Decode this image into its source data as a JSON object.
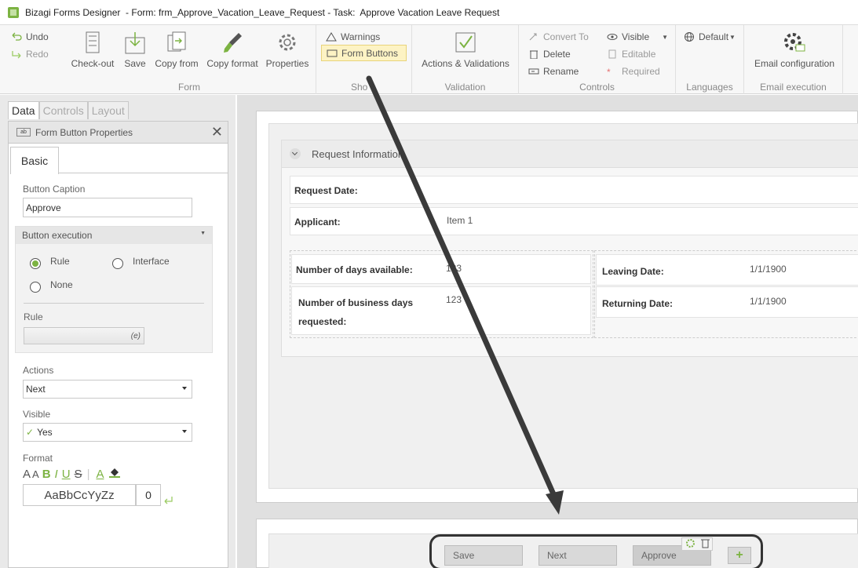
{
  "window": {
    "title": "Bizagi Forms Designer  - Form: frm_Approve_Vacation_Leave_Request - Task:  Approve Vacation Leave Request"
  },
  "ribbon": {
    "undo": "Undo",
    "redo": "Redo",
    "form_group": {
      "label": "Form",
      "checkout": "Check-out",
      "save": "Save",
      "copy_from": "Copy from",
      "copy_format": "Copy format",
      "properties": "Properties"
    },
    "show_group": {
      "label": "Sho",
      "warnings": "Warnings",
      "form_buttons": "Form Buttons"
    },
    "validation_group": {
      "label": "Validation",
      "actions": "Actions & Validations"
    },
    "controls_group": {
      "label": "Controls",
      "convert_to": "Convert To",
      "delete": "Delete",
      "rename": "Rename",
      "visible": "Visible",
      "editable": "Editable",
      "required": "Required"
    },
    "languages_group": {
      "label": "Languages",
      "default": "Default"
    },
    "email_group": {
      "label": "Email execution",
      "email_config": "Email configuration"
    }
  },
  "left_panel": {
    "tabs": [
      "Data",
      "Controls",
      "Layout"
    ],
    "panel_title": "Form Button Properties",
    "basic_tab": "Basic",
    "button_caption_label": "Button Caption",
    "button_caption_value": "Approve",
    "button_execution_label": "Button execution",
    "radio_rule": "Rule",
    "radio_interface": "Interface",
    "radio_none": "None",
    "rule_label": "Rule",
    "rule_icon_text": "(e)",
    "actions_label": "Actions",
    "actions_value": "Next",
    "visible_label": "Visible",
    "visible_value": "Yes",
    "format_label": "Format",
    "format_sample": "AaBbCcYyZz",
    "format_size": "0"
  },
  "canvas": {
    "group_title": "Request Information",
    "request_date_label": "Request Date:",
    "applicant_label": "Applicant:",
    "applicant_value": "Item 1",
    "days_available_label": "Number of days available:",
    "days_available_value": "123",
    "business_days_label_1": "Number of business days",
    "business_days_label_2": "requested:",
    "business_days_value": "123",
    "leaving_date_label": "Leaving Date:",
    "leaving_date_value": "1/1/1900",
    "returning_date_label": "Returning Date:",
    "returning_date_value": "1/1/1900",
    "buttons": [
      "Save",
      "Next",
      "Approve"
    ]
  },
  "colors": {
    "accent_green": "#7cb342",
    "highlight_yellow": "#fdf3c4"
  }
}
